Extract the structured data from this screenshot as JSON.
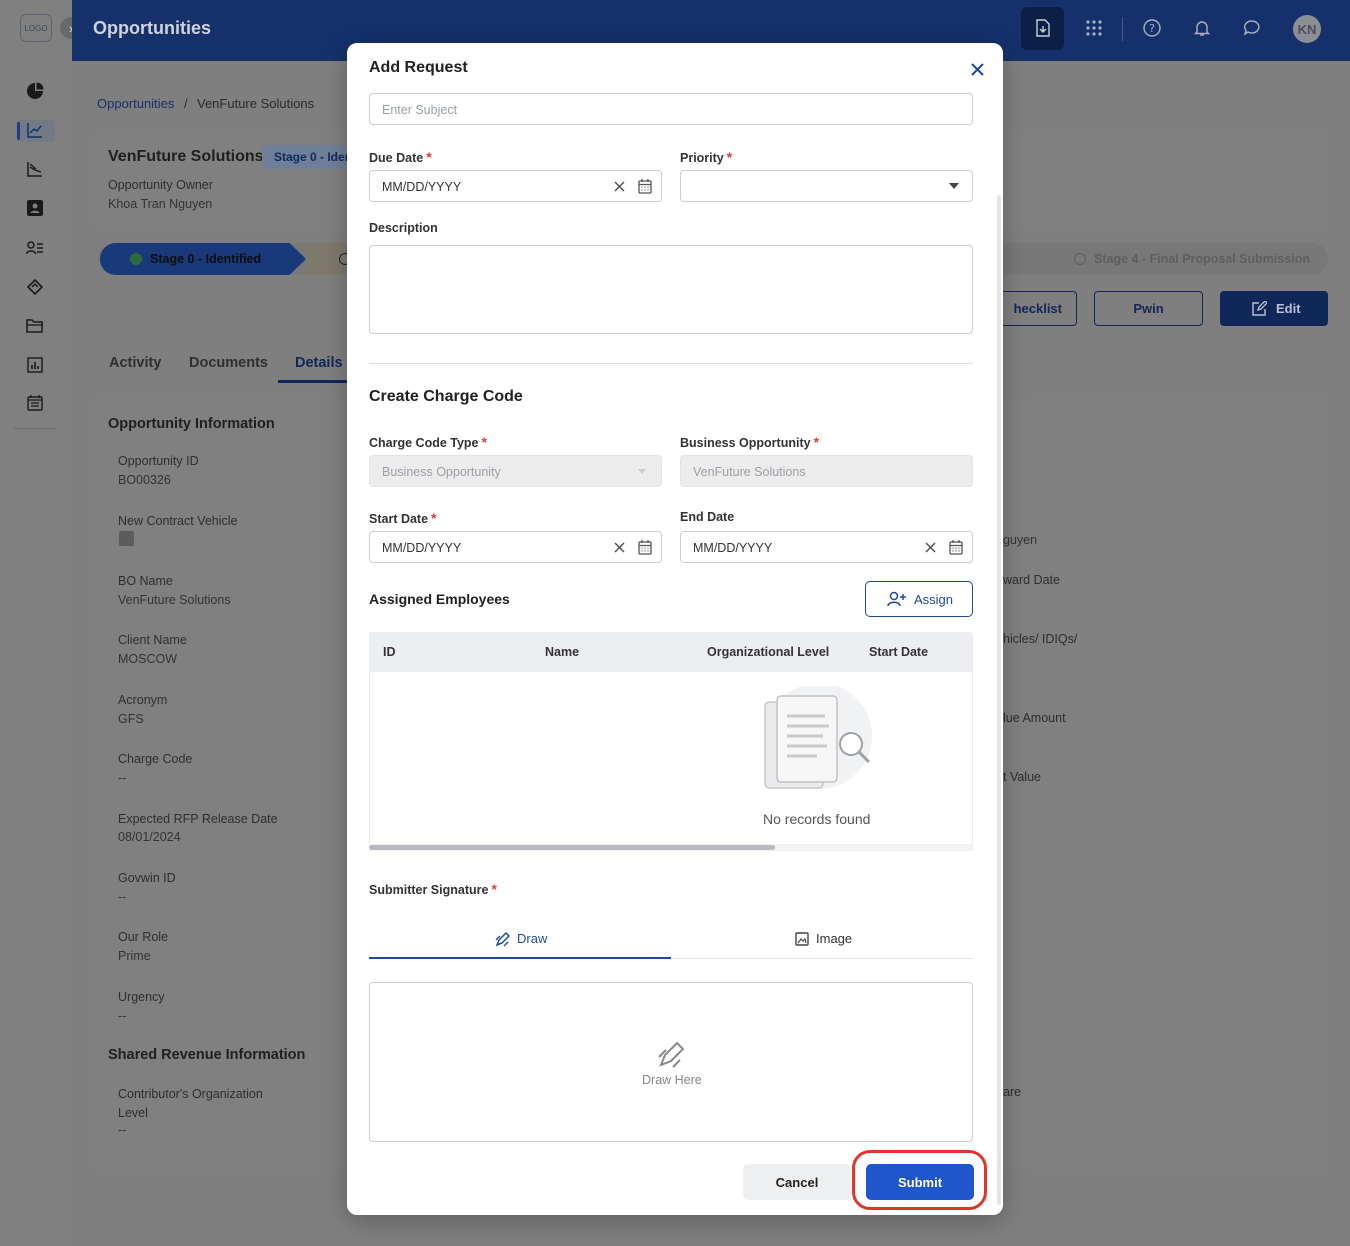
{
  "app": {
    "logo": "LOGO",
    "title": "Opportunities",
    "avatar_initials": "KN",
    "sidebar_icons": [
      "pie-chart-icon",
      "trend-chart-icon",
      "line-chart-icon",
      "contact-card-icon",
      "user-list-icon",
      "handshake-icon",
      "folder-icon",
      "bar-chart-icon",
      "calendar-list-icon"
    ],
    "topbar_icons": [
      "download-icon",
      "apps-grid-icon",
      "help-icon",
      "bell-icon",
      "chat-icon"
    ]
  },
  "breadcrumb": {
    "root": "Opportunities",
    "separator": "/",
    "current": "VenFuture Solutions"
  },
  "opportunity": {
    "name": "VenFuture Solutions",
    "stage_badge": "Stage 0 - Ider",
    "owner_label": "Opportunity Owner",
    "owner_name": "Khoa Tran Nguyen"
  },
  "stages": {
    "first": "Stage 0 - Identified",
    "last": "Stage 4 - Final Proposal Submission"
  },
  "actions": {
    "checklist": "hecklist",
    "pwin": "Pwin",
    "edit": "Edit"
  },
  "tabs": [
    "Activity",
    "Documents",
    "Details"
  ],
  "details": {
    "section_title": "Opportunity Information",
    "fields": [
      {
        "label": "Opportunity ID",
        "value": "BO00326"
      },
      {
        "label": "New Contract Vehicle",
        "value": ""
      },
      {
        "label": "BO Name",
        "value": "VenFuture Solutions"
      },
      {
        "label": "Client Name",
        "value": "MOSCOW"
      },
      {
        "label": "Acronym",
        "value": "GFS"
      },
      {
        "label": "Charge Code",
        "value": "--"
      },
      {
        "label": "Expected RFP Release Date",
        "value": "08/01/2024"
      },
      {
        "label": "Govwin ID",
        "value": "--"
      },
      {
        "label": "Our Role",
        "value": "Prime"
      },
      {
        "label": "Urgency",
        "value": "--"
      }
    ],
    "shared_title": "Shared Revenue Information",
    "shared_field_label": "Contributor's Organization Level",
    "shared_field_value": "--",
    "right_fragments": [
      "guyen",
      "ward Date",
      "hicles/ IDIQs/",
      "lue Amount",
      "t Value",
      "are"
    ]
  },
  "modal": {
    "title": "Add Request",
    "subject_placeholder": "Enter Subject",
    "due_date_label": "Due Date",
    "due_date_placeholder": "MM/DD/YYYY",
    "priority_label": "Priority",
    "description_label": "Description",
    "charge_code_title": "Create Charge Code",
    "charge_code_type_label": "Charge Code Type",
    "charge_code_type_value": "Business Opportunity",
    "business_opportunity_label": "Business Opportunity",
    "business_opportunity_value": "VenFuture Solutions",
    "start_date_label": "Start Date",
    "start_date_placeholder": "MM/DD/YYYY",
    "end_date_label": "End Date",
    "end_date_placeholder": "MM/DD/YYYY",
    "assigned_title": "Assigned Employees",
    "assign_button": "Assign",
    "table_headers": [
      "ID",
      "Name",
      "Organizational Level",
      "Start Date"
    ],
    "empty_text": "No records found",
    "signature_label": "Submitter Signature",
    "tab_draw": "Draw",
    "tab_image": "Image",
    "draw_here": "Draw Here",
    "cancel": "Cancel",
    "submit": "Submit",
    "required_mark": "*"
  }
}
